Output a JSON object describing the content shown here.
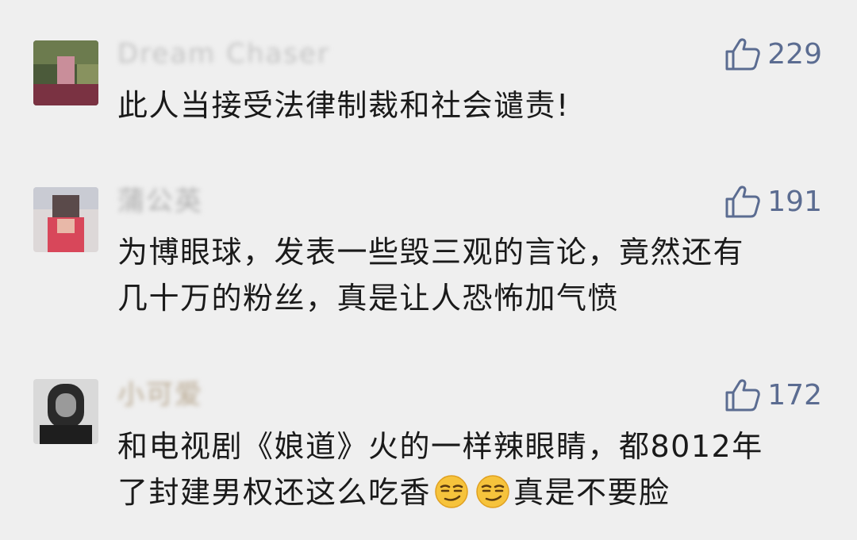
{
  "comments": [
    {
      "username": "Dream Chaser",
      "likes": "229",
      "lines": [
        "此人当接受法律制裁和社会谴责!"
      ]
    },
    {
      "username": "蒲公英",
      "likes": "191",
      "lines": [
        "为博眼球，发表一些毁三观的言论，竟然还有",
        "几十万的粉丝，真是让人恐怖加气愤"
      ]
    },
    {
      "username": "小可爱",
      "likes": "172",
      "lines": [
        "和电视剧《娘道》火的一样辣眼睛，都8012年"
      ],
      "line2_before": "了封建男权还这么吃香",
      "line2_after": "真是不要脸",
      "emojis": [
        "smirk-emoji",
        "smirk-emoji"
      ]
    }
  ],
  "icons": {
    "like": "thumbs-up-icon"
  },
  "colors": {
    "background": "#efefef",
    "like_accent": "#5b6c91",
    "text": "#1a1a1a"
  }
}
